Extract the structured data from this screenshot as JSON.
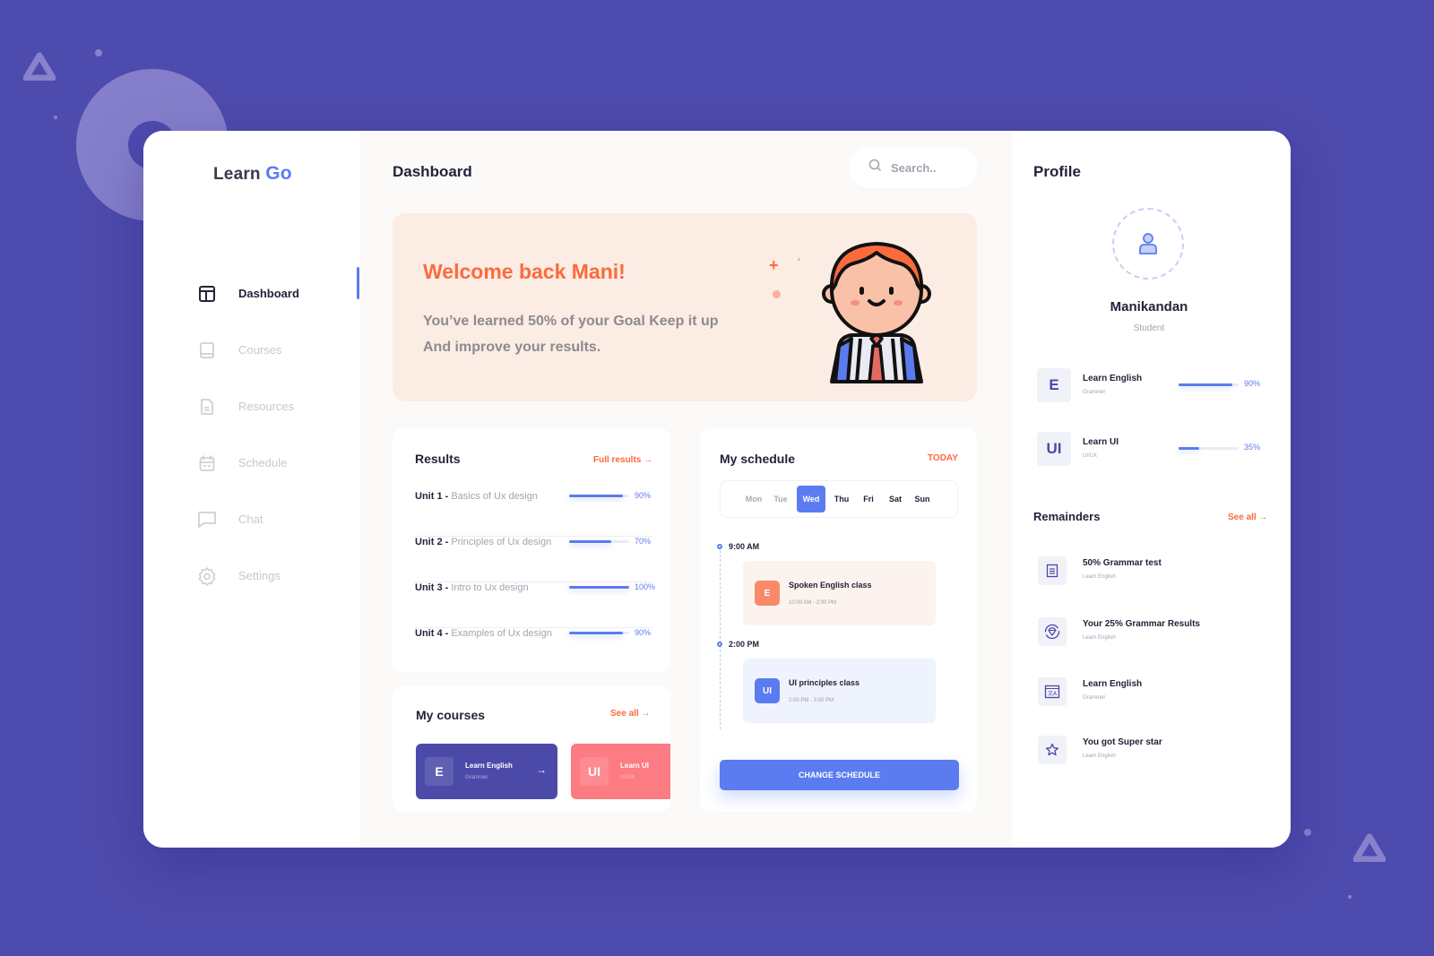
{
  "brand": {
    "part1": "Learn",
    "part2": "Go"
  },
  "sidebar": {
    "items": [
      {
        "label": "Dashboard",
        "icon": "layout-icon",
        "active": true
      },
      {
        "label": "Courses",
        "icon": "book-icon",
        "active": false
      },
      {
        "label": "Resources",
        "icon": "document-icon",
        "active": false
      },
      {
        "label": "Schedule",
        "icon": "calendar-icon",
        "active": false
      },
      {
        "label": "Chat",
        "icon": "chat-icon",
        "active": false
      },
      {
        "label": "Settings",
        "icon": "gear-icon",
        "active": false
      }
    ]
  },
  "header": {
    "title": "Dashboard",
    "search_placeholder": "Search.."
  },
  "hero": {
    "title": "Welcome back Mani!",
    "line1": "You’ve learned 50% of your Goal Keep it up",
    "line2": "And improve your results.",
    "goal_progress_percent": 50
  },
  "results": {
    "title": "Results",
    "link": "Full results →",
    "rows": [
      {
        "unit": "Unit 1 - ",
        "topic": "Basics of Ux design",
        "value": 90,
        "label": "90%"
      },
      {
        "unit": "Unit 2 - ",
        "topic": "Principles of Ux design",
        "value": 70,
        "label": "70%"
      },
      {
        "unit": "Unit 3 - ",
        "topic": "Intro to Ux design",
        "value": 100,
        "label": "100%"
      },
      {
        "unit": "Unit 4 - ",
        "topic": "Examples of Ux design",
        "value": 90,
        "label": "90%"
      }
    ]
  },
  "my_courses": {
    "title": "My courses",
    "link": "See all →",
    "items": [
      {
        "badge": "E",
        "title": "Learn English",
        "subtitle": "Grammer",
        "color": "#4b4aa9",
        "arrow": "→"
      },
      {
        "badge": "UI",
        "title": "Learn UI",
        "subtitle": "UI/UX",
        "color": "#fd7b82"
      }
    ]
  },
  "schedule": {
    "title": "My schedule",
    "today_label": "TODAY",
    "days": [
      {
        "label": "Mon",
        "state": "past"
      },
      {
        "label": "Tue",
        "state": "past"
      },
      {
        "label": "Wed",
        "state": "active"
      },
      {
        "label": "Thu",
        "state": "future"
      },
      {
        "label": "Fri",
        "state": "future"
      },
      {
        "label": "Sat",
        "state": "future"
      },
      {
        "label": "Sun",
        "state": "future"
      }
    ],
    "slots": [
      {
        "time": "9:00 AM",
        "event": {
          "badge": "E",
          "title": "Spoken English class",
          "range": "10:00 AM - 2:00 PM",
          "bg": "#fcf3ee",
          "badge_color": "#f88a6a"
        }
      },
      {
        "time": "2:00 PM",
        "event": {
          "badge": "UI",
          "title": "UI principles class",
          "range": "2:00 PM - 3:00 PM",
          "bg": "#eff3fe",
          "badge_color": "#5b7cf0"
        }
      }
    ],
    "button": "CHANGE SCHEDULE"
  },
  "profile": {
    "title": "Profile",
    "name": "Manikandan",
    "role": "Student",
    "courses": [
      {
        "badge": "E",
        "title": "Learn English",
        "subtitle": "Grammer",
        "value": 90,
        "label": "90%"
      },
      {
        "badge": "UI",
        "title": "Learn UI",
        "subtitle": "UI/UX",
        "value": 35,
        "label": "35%"
      }
    ]
  },
  "reminders": {
    "title": "Remainders",
    "link": "See all →",
    "items": [
      {
        "icon": "clipboard-icon",
        "title": "50% Grammar test",
        "subtitle": "Learn English"
      },
      {
        "icon": "diamond-icon",
        "title": "Your 25% Grammar Results",
        "subtitle": "Learn English"
      },
      {
        "icon": "translate-icon",
        "title": "Learn English",
        "subtitle": "Grammer"
      },
      {
        "icon": "star-icon",
        "title": "You got Super star",
        "subtitle": "Learn English"
      }
    ]
  },
  "colors": {
    "background": "#4e4bae",
    "accent_blue": "#5b7cf0",
    "accent_orange": "#fb6b3d",
    "hero_bg": "#fbece4"
  }
}
